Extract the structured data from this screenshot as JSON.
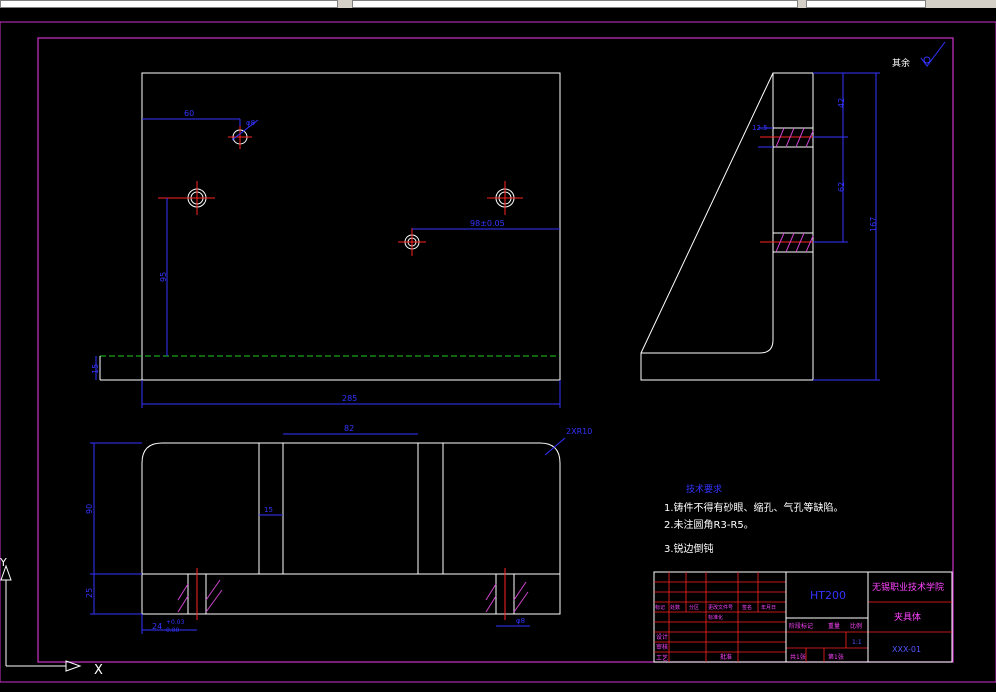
{
  "colors": {
    "background": "#000000",
    "outline": "#ffffff",
    "border": "#cc33cc",
    "dimension": "#3333ff",
    "center": "#ff2222",
    "hatch": "#cc44cc",
    "ground": "#22cc22",
    "note": "#ffffff",
    "title_text": "#ff44ff",
    "title_blue": "#5555ff"
  },
  "roughness": {
    "label": "其余",
    "icon": "surface-finish-icon"
  },
  "dimensions": {
    "hole_x": "60",
    "hole_diam": "φ8",
    "right_hole": "98±0.05",
    "vertical_hole": "95",
    "ground_height": "15",
    "width": "285",
    "slot": "82",
    "slot_width": "15",
    "fillet": "2XR10",
    "front_height": "90",
    "base_height": "25",
    "bolt_left": "24",
    "tol_upper": "+0.03",
    "tol_lower": "0.00",
    "bolt_right": "φ8",
    "side_depth": "12.5",
    "side_top": "42",
    "side_mid": "62",
    "side_total": "167"
  },
  "notes": {
    "title": "技术要求",
    "items": [
      "1.铸件不得有砂眼、缩孔、气孔等缺陷。",
      "2.未注圆角R3-R5。",
      "3.锐边倒钝"
    ]
  },
  "title_block": {
    "material": "HT200",
    "school": "无锡职业技术学院",
    "part_name": "夹具体",
    "drawing_no": "XXX-01",
    "row_labels": [
      "标记",
      "处数",
      "分区",
      "更改文件号",
      "签名",
      "年月日"
    ],
    "left_labels": [
      "设计",
      "审核",
      "工艺"
    ],
    "std_label": "标准化",
    "approve_label": "批准",
    "stage_labels": [
      "阶段标记",
      "重量",
      "比例"
    ],
    "ratio": "1:1",
    "sheets": [
      "共1张",
      "第1张"
    ]
  },
  "ucs": {
    "x_label": "X",
    "y_label": "Y"
  }
}
